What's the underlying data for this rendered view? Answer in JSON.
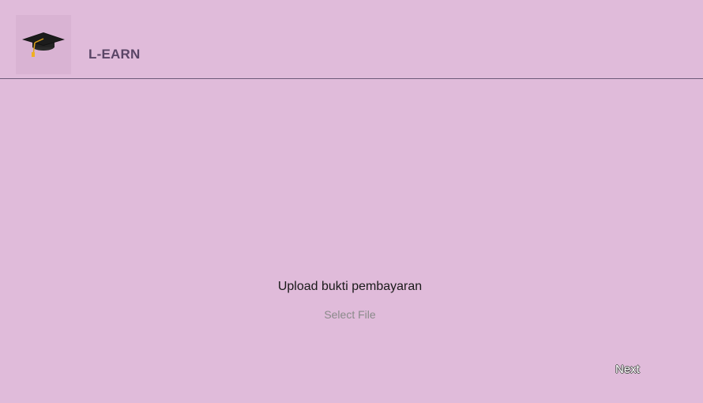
{
  "header": {
    "logo_icon": "graduation-cap-icon",
    "title": "L-EARN"
  },
  "main": {
    "upload_label": "Upload bukti pembayaran",
    "select_file_label": "Select File"
  },
  "footer": {
    "next_label": "Next"
  },
  "colors": {
    "background": "#e0bbda",
    "logo_box": "#d9b3d3",
    "title": "#5a4566",
    "divider": "#6e5a7a",
    "select_file": "#8a8a8a"
  }
}
